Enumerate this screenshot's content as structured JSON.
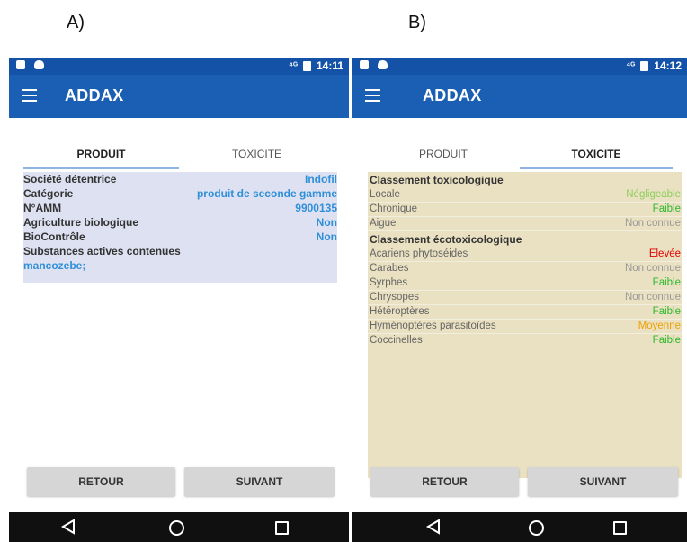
{
  "labels": {
    "a": "A)",
    "b": "B)"
  },
  "colors": {
    "statusbar": "#1452a8",
    "appbar": "#1a5fb4",
    "panel_a_bg": "#dde1f1",
    "panel_b_bg": "#e9e1c1",
    "link_blue": "#2f8fd8",
    "level_green": "#2eb82e",
    "level_light_green": "#8ccf5a",
    "level_grey": "#999999",
    "level_red": "#e00000",
    "level_orange": "#f0a000"
  },
  "phone_a": {
    "status": {
      "time": "14:11",
      "signal": "⁴ᴳ"
    },
    "app_title": "ADDAX",
    "tabs": [
      {
        "label": "PRODUIT",
        "active": true
      },
      {
        "label": "TOXICITE",
        "active": false
      }
    ],
    "rows": [
      {
        "label": "Société détentrice",
        "value": "Indofil"
      },
      {
        "label": "Catégorie",
        "value": "produit de seconde gamme"
      },
      {
        "label": "N°AMM",
        "value": "9900135"
      },
      {
        "label": "Agriculture biologique",
        "value": "Non"
      },
      {
        "label": "BioContrôle",
        "value": "Non"
      }
    ],
    "substances_label": "Substances actives contenues",
    "substances_value": "mancozebe;",
    "buttons": {
      "back": "RETOUR",
      "next": "SUIVANT"
    }
  },
  "phone_b": {
    "status": {
      "time": "14:12",
      "signal": "⁴ᴳ"
    },
    "app_title": "ADDAX",
    "tabs": [
      {
        "label": "PRODUIT",
        "active": false
      },
      {
        "label": "TOXICITE",
        "active": true
      }
    ],
    "tox_title": "Classement toxicologique",
    "tox_rows": [
      {
        "label": "Locale",
        "value": "Négligeable",
        "color": "#8ccf5a"
      },
      {
        "label": "Chronique",
        "value": "Faible",
        "color": "#2eb82e"
      },
      {
        "label": "Aigue",
        "value": "Non connue",
        "color": "#999999"
      }
    ],
    "eco_title": "Classement écotoxicologique",
    "eco_rows": [
      {
        "label": "Acariens phytoséides",
        "value": "Elevée",
        "color": "#e00000"
      },
      {
        "label": "Carabes",
        "value": "Non connue",
        "color": "#999999"
      },
      {
        "label": "Syrphes",
        "value": "Faible",
        "color": "#2eb82e"
      },
      {
        "label": "Chrysopes",
        "value": "Non connue",
        "color": "#999999"
      },
      {
        "label": "Hétéroptères",
        "value": "Faible",
        "color": "#2eb82e"
      },
      {
        "label": "Hyménoptères parasitoïdes",
        "value": "Moyenne",
        "color": "#f0a000"
      },
      {
        "label": "Coccinelles",
        "value": "Faible",
        "color": "#2eb82e"
      }
    ],
    "buttons": {
      "back": "RETOUR",
      "next": "SUIVANT"
    }
  },
  "icons": {
    "menu": "hamburger-icon",
    "back": "back-triangle-icon",
    "home": "home-circle-icon",
    "recent": "recent-square-icon"
  }
}
